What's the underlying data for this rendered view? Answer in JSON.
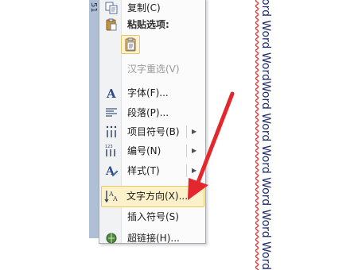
{
  "document": {
    "strip_label": "51",
    "word_column_1": "Word Word WordWord Word Word Word Word Word",
    "word_column_2": "Word Word WordWord Word Word Word Word Word"
  },
  "context_menu": {
    "items": [
      {
        "label": "复制(C)",
        "icon": "copy-icon"
      },
      {
        "label": "粘贴选项:",
        "icon": "clipboard-icon"
      },
      {
        "label": "",
        "icon": "paste-keep-text-icon"
      },
      {
        "label": "汉字重选(V)",
        "icon": ""
      },
      {
        "label": "字体(F)...",
        "icon": "font-icon"
      },
      {
        "label": "段落(P)...",
        "icon": "paragraph-icon"
      },
      {
        "label": "项目符号(B)",
        "icon": "bullets-icon"
      },
      {
        "label": "编号(N)",
        "icon": "numbering-icon"
      },
      {
        "label": "样式(T)",
        "icon": "styles-icon"
      },
      {
        "label": "文字方向(X)...",
        "icon": "text-direction-icon"
      },
      {
        "label": "插入符号(S)",
        "icon": ""
      },
      {
        "label": "超链接(H)...",
        "icon": "hyperlink-icon"
      }
    ]
  },
  "colors": {
    "highlight": "#fdf1c9",
    "arrow": "#e4262d"
  }
}
